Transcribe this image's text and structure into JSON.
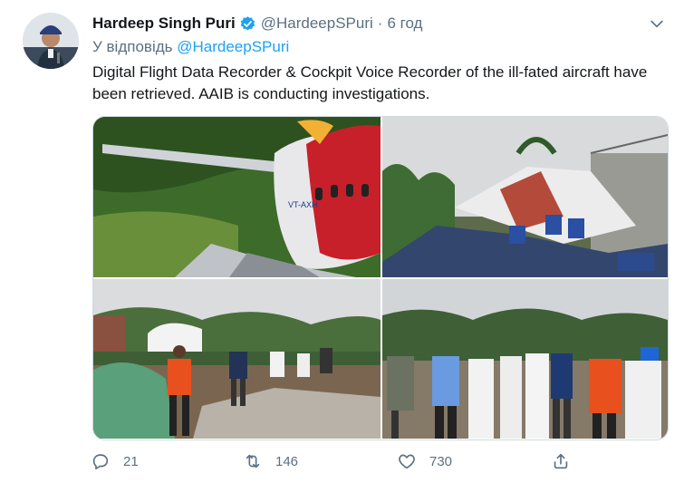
{
  "tweet": {
    "author_name": "Hardeep Singh Puri",
    "handle": "@HardeepSPuri",
    "separator": "·",
    "time": "6 год",
    "reply_prefix": "У відповідь",
    "reply_to": "@HardeepSPuri",
    "text": "Digital Flight Data Recorder & Cockpit Voice Recorder of the ill-fated aircraft have been retrieved. AAIB is conducting investigations.",
    "aircraft_tail": "VT-AXH"
  },
  "actions": {
    "replies": "21",
    "retweets": "146",
    "likes": "730"
  },
  "icons": {
    "verified": "verified-badge-icon",
    "more": "chevron-down-icon",
    "reply": "reply-icon",
    "retweet": "retweet-icon",
    "like": "heart-icon",
    "share": "share-icon"
  },
  "colors": {
    "accent": "#1da1f2",
    "secondary_text": "#5b7083",
    "primary_text": "#14171a"
  }
}
